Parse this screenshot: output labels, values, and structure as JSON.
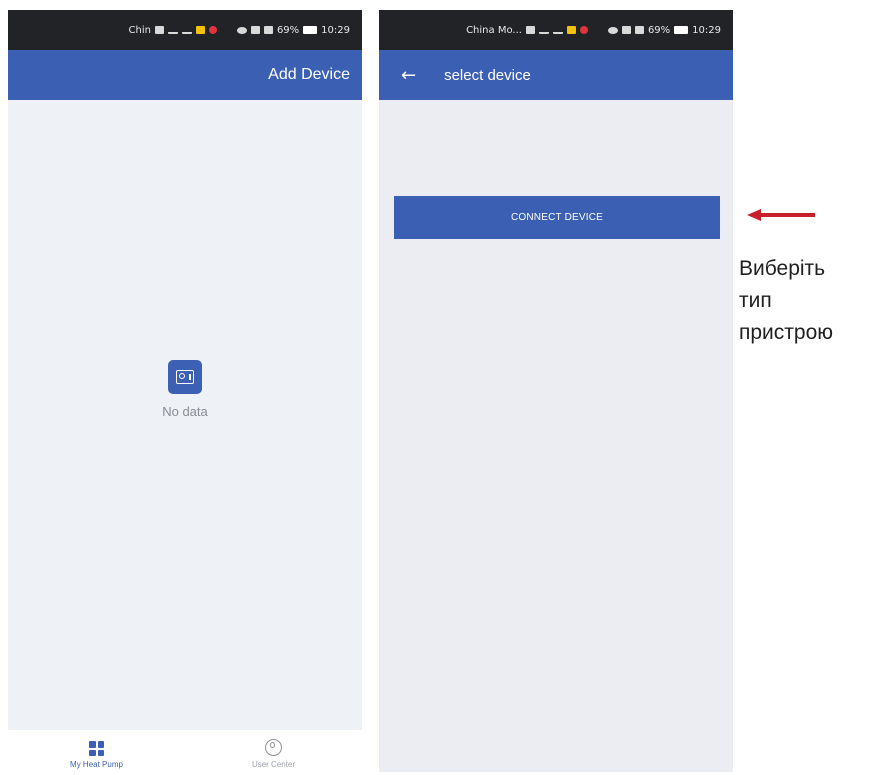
{
  "screen_home": {
    "status_bar": {
      "carrier": "Chin",
      "battery": "69%",
      "time": "10:29"
    },
    "app_bar": {
      "action_label": "Add Device"
    },
    "empty_state": {
      "icon": "safe-box-icon",
      "text": "No data"
    },
    "bottom_nav": [
      {
        "label": "My Heat Pump",
        "icon": "grid-icon",
        "active": true
      },
      {
        "label": "User Center",
        "icon": "user-circle-icon",
        "active": false
      }
    ]
  },
  "screen_select": {
    "status_bar": {
      "carrier": "China Mo...",
      "battery": "69%",
      "time": "10:29"
    },
    "app_bar": {
      "back_icon": "←",
      "title": "select device"
    },
    "connect_button": {
      "label": "CONNECT DEVICE"
    }
  },
  "annotation": {
    "lines": [
      "Виберіть",
      "тип",
      "пристрою"
    ],
    "arrow_color": "#c8202a"
  },
  "colors": {
    "primary": "#3b5fb3",
    "status_bar": "#222326",
    "background": "#eef1f6"
  }
}
